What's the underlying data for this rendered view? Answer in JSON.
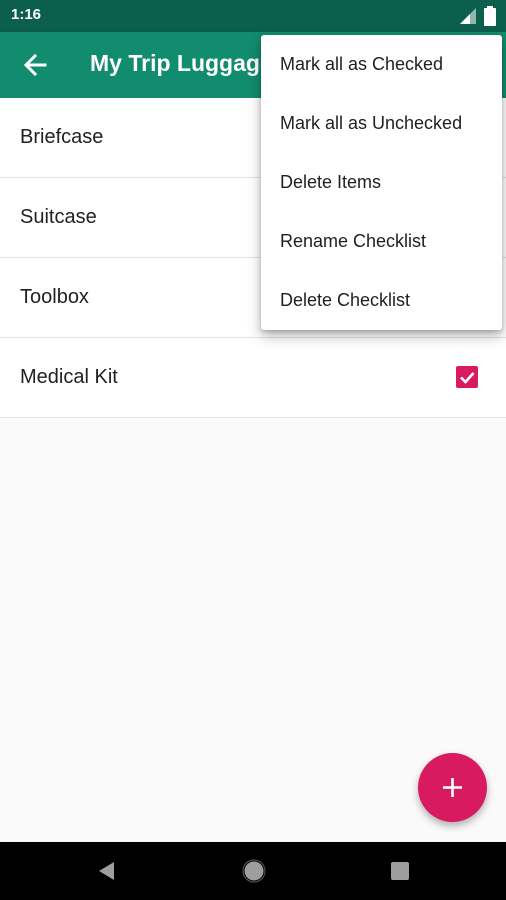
{
  "status_bar": {
    "time": "1:16",
    "icons": [
      "signal-icon",
      "battery-icon"
    ]
  },
  "app_bar": {
    "title": "My Trip Luggage",
    "back_icon": "arrow-back-icon",
    "color": "#128c6e"
  },
  "items": [
    {
      "label": "Briefcase",
      "checked": false
    },
    {
      "label": "Suitcase",
      "checked": false
    },
    {
      "label": "Toolbox",
      "checked": false
    },
    {
      "label": "Medical Kit",
      "checked": true
    }
  ],
  "menu": {
    "items": [
      {
        "label": "Mark all as Checked"
      },
      {
        "label": "Mark all as Unchecked"
      },
      {
        "label": "Delete Items"
      },
      {
        "label": "Rename Checklist"
      },
      {
        "label": "Delete Checklist"
      }
    ]
  },
  "fab": {
    "icon": "plus-icon",
    "color": "#d81b60"
  },
  "nav_bar": {
    "icons": [
      "back-triangle-icon",
      "home-circle-icon",
      "recents-square-icon"
    ]
  },
  "colors": {
    "accent": "#d81b60",
    "status_bar": "#0c5e4d",
    "primary": "#128c6e"
  }
}
